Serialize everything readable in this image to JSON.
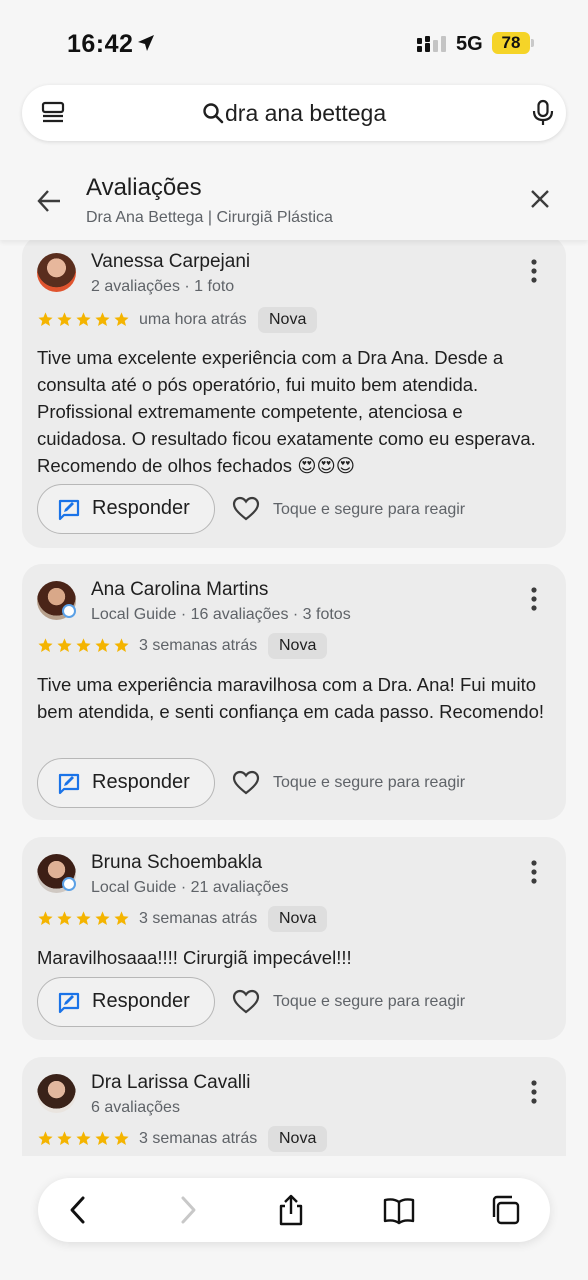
{
  "status_bar": {
    "time": "16:42",
    "network": "5G",
    "battery": "78",
    "icons": [
      "location-arrow-icon",
      "signal-icon",
      "battery-icon"
    ]
  },
  "search": {
    "query": "dra ana bettega",
    "icons": [
      "menu-icon",
      "search-icon",
      "mic-icon"
    ]
  },
  "header": {
    "title": "Avaliações",
    "subtitle": "Dra Ana Bettega | Cirurgiã Plástica",
    "icons": [
      "back-arrow-icon",
      "close-icon"
    ]
  },
  "reviews": [
    {
      "name": "Vanessa Carpejani",
      "meta": "2 avaliações · 1 foto",
      "rating": 5,
      "time": "uma hora atrás",
      "badge": "Nova",
      "text": "Tive uma excelente experiência com a Dra Ana. Desde a consulta até o pós operatório, fui muito bem atendida. Profissional extremamente competente, atenciosa e cuidadosa. O resultado ficou exatamente como eu esperava. Recomendo de olhos fechados 😍😍😍",
      "reply_label": "Responder",
      "react_label": "Toque e segure para reagir"
    },
    {
      "name": "Ana Carolina Martins",
      "meta": "Local Guide · 16 avaliações · 3 fotos",
      "rating": 5,
      "time": "3 semanas atrás",
      "badge": "Nova",
      "text": "Tive uma experiência maravilhosa com a Dra. Ana! Fui muito bem atendida, e senti confiança em cada passo. Recomendo!",
      "reply_label": "Responder",
      "react_label": "Toque e segure para reagir"
    },
    {
      "name": "Bruna Schoembakla",
      "meta": "Local Guide · 21 avaliações",
      "rating": 5,
      "time": "3 semanas atrás",
      "badge": "Nova",
      "text": "Maravilhosaaa!!!! Cirurgiã impecável!!!",
      "reply_label": "Responder",
      "react_label": "Toque e segure para reagir"
    },
    {
      "name": "Dra Larissa Cavalli",
      "meta": "6 avaliações",
      "rating": 5,
      "time": "3 semanas atrás",
      "badge": "Nova"
    }
  ],
  "toolbar": {
    "icons": [
      "back-icon",
      "forward-icon",
      "share-icon",
      "bookmarks-icon",
      "tabs-icon"
    ]
  },
  "colors": {
    "star": "#f4b400",
    "reply_icon": "#1a73e8",
    "card_bg": "#ececec",
    "page_bg": "#f6f6f6",
    "battery": "#f5d428"
  }
}
